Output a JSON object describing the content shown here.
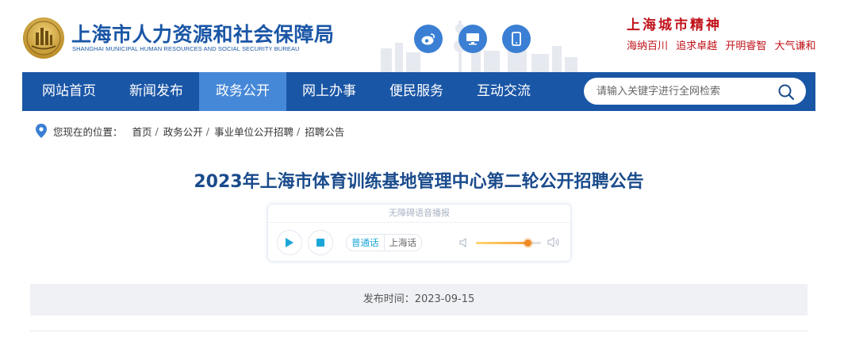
{
  "header": {
    "site_name": "上海市人力资源和社会保障局",
    "site_name_en": "SHANGHAI MUNICIPAL HUMAN RESOURCES AND SOCIAL SECURITY BUREAU",
    "quick_icons": [
      "weibo-icon",
      "computer-icon",
      "mobile-icon"
    ],
    "spirit_title": "上海城市精神",
    "spirit_items": [
      "海纳百川",
      "追求卓越",
      "开明睿智",
      "大气谦和"
    ]
  },
  "nav": {
    "items": [
      "网站首页",
      "新闻发布",
      "政务公开",
      "网上办事",
      "便民服务",
      "互动交流"
    ],
    "active": "政务公开",
    "search_placeholder": "请输入关键字进行全网检索"
  },
  "breadcrumb": {
    "label": "您现在的位置：",
    "items": [
      "首页",
      "政务公开",
      "事业单位公开招聘",
      "招聘公告"
    ]
  },
  "article": {
    "title": "2023年上海市体育训练基地管理中心第二轮公开招聘公告",
    "publish_text": "发布时间：2023-09-15"
  },
  "player": {
    "header": "无障碍语音播报",
    "lang_active": "普通话",
    "lang_other": "上海话",
    "volume": 0.8
  },
  "colors": {
    "brand_blue": "#1a56a6",
    "nav_active": "#4688d8",
    "spirit_red": "#c0121a",
    "title_blue": "#1a4b8c"
  }
}
